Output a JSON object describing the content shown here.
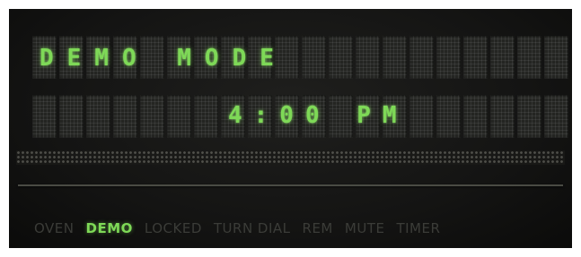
{
  "display": {
    "line1": "DEMO MODE",
    "line2": "4:00 PM",
    "lit_color": "#7ed957",
    "unlit_color": "#3b3c38",
    "background_color": "#141413"
  },
  "indicators": [
    {
      "label": "OVEN",
      "active": false
    },
    {
      "label": "DEMO",
      "active": true
    },
    {
      "label": "LOCKED",
      "active": false
    },
    {
      "label": "TURN DIAL",
      "active": false
    },
    {
      "label": "REM",
      "active": false
    },
    {
      "label": "MUTE",
      "active": false
    },
    {
      "label": "TIMER",
      "active": false
    }
  ]
}
